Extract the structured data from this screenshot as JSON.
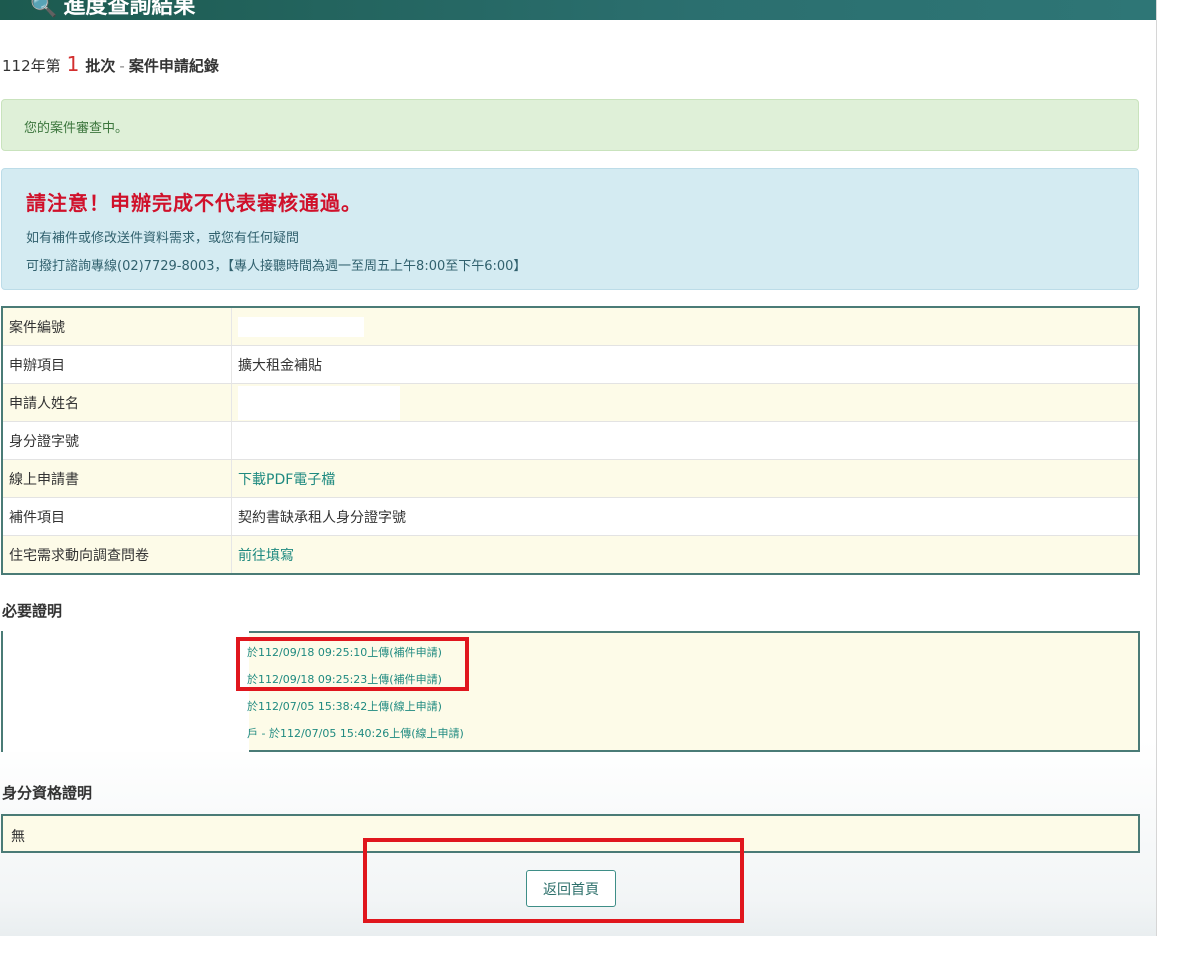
{
  "header": {
    "title": "進度查詢結果"
  },
  "batch": {
    "year": "112年第",
    "number": "1",
    "unit": "批次",
    "separator": "-",
    "label": "案件申請紀錄"
  },
  "status_alert": "您的案件審查中。",
  "notice": {
    "warning": "請注意！申辦完成不代表審核通過。",
    "line1": "如有補件或修改送件資料需求，或您有任何疑問",
    "line2": "可撥打諮詢專線(02)7729-8003，【專人接聽時間為週一至周五上午8:00至下午6:00】"
  },
  "info_table": {
    "rows": [
      {
        "key": "案件編號",
        "value": ""
      },
      {
        "key": "申辦項目",
        "value": "擴大租金補貼"
      },
      {
        "key": "申請人姓名",
        "value": ""
      },
      {
        "key": "身分證字號",
        "value": ""
      },
      {
        "key": "線上申請書",
        "value": "下載PDF電子檔"
      },
      {
        "key": "補件項目",
        "value": "契約書缺承租人身分證字號"
      },
      {
        "key": "住宅需求動向調查問卷",
        "value": "前往填寫"
      }
    ]
  },
  "required_docs": {
    "title": "必要證明",
    "files": [
      "於112/09/18 09:25:10上傳(補件申請)",
      "於112/09/18 09:25:23上傳(補件申請)",
      "於112/07/05 15:38:42上傳(線上申請)",
      "戶 - 於112/07/05 15:40:26上傳(線上申請)"
    ]
  },
  "identity_docs": {
    "title": "身分資格證明",
    "value": "無"
  },
  "back_button": "返回首頁",
  "colors": {
    "header": "#1c5a4f",
    "accent": "#1f8a80",
    "warning": "#d0112b",
    "highlight": "#e0161d"
  }
}
